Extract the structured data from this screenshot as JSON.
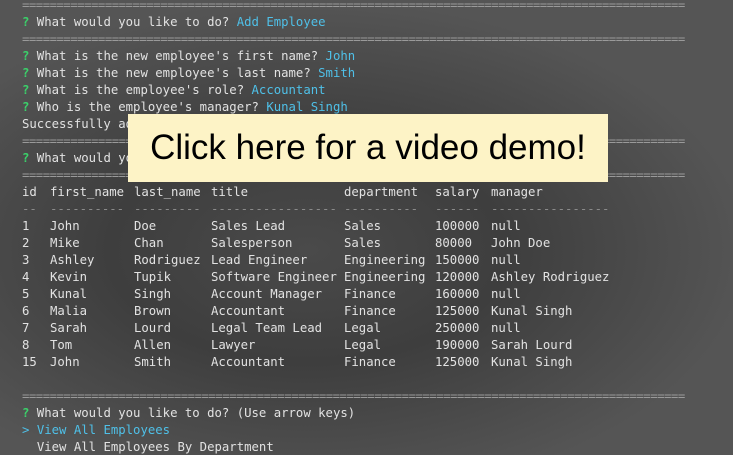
{
  "separator": "================================================================================================",
  "prompts": [
    {
      "q": "?",
      "text": " What would you like to do? ",
      "answer": "Add Employee"
    },
    {
      "q": "?",
      "text": " What is the new employee's first name? ",
      "answer": "John"
    },
    {
      "q": "?",
      "text": " What is the new employee's last name? ",
      "answer": "Smith"
    },
    {
      "q": "?",
      "text": " What is the employee's role? ",
      "answer": "Accountant"
    },
    {
      "q": "?",
      "text": " Who is the employee's manager? ",
      "answer": "Kunal Singh"
    }
  ],
  "success_msg": "Successfully ad",
  "second_prompt": {
    "q": "?",
    "text": " What would yo"
  },
  "banner": "Click here for a video demo!",
  "table": {
    "headers": [
      "id",
      "first_name",
      "last_name",
      "title",
      "department",
      "salary",
      "manager"
    ],
    "dividers": [
      "--",
      "----------",
      "---------",
      "-----------------",
      "----------",
      "------",
      "----------------"
    ],
    "rows": [
      [
        "1",
        "John",
        "Doe",
        "Sales Lead",
        "Sales",
        "100000",
        "null"
      ],
      [
        "2",
        "Mike",
        "Chan",
        "Salesperson",
        "Sales",
        "80000",
        "John Doe"
      ],
      [
        "3",
        "Ashley",
        "Rodriguez",
        "Lead Engineer",
        "Engineering",
        "150000",
        "null"
      ],
      [
        "4",
        "Kevin",
        "Tupik",
        "Software Engineer",
        "Engineering",
        "120000",
        "Ashley Rodriguez"
      ],
      [
        "5",
        "Kunal",
        "Singh",
        "Account Manager",
        "Finance",
        "160000",
        "null"
      ],
      [
        "6",
        "Malia",
        "Brown",
        "Accountant",
        "Finance",
        "125000",
        "Kunal Singh"
      ],
      [
        "7",
        "Sarah",
        "Lourd",
        "Legal Team Lead",
        "Legal",
        "250000",
        "null"
      ],
      [
        "8",
        "Tom",
        "Allen",
        "Lawyer",
        "Legal",
        "190000",
        "Sarah Lourd"
      ],
      [
        "15",
        "John",
        "Smith",
        "Accountant",
        "Finance",
        "125000",
        "Kunal Singh"
      ]
    ]
  },
  "final_prompt": {
    "q": "?",
    "text": " What would you like to do? (Use arrow keys)"
  },
  "menu": [
    {
      "marker": "> ",
      "label": "View All Employees"
    },
    {
      "marker": "  ",
      "label": "View All Employees By Department"
    }
  ]
}
